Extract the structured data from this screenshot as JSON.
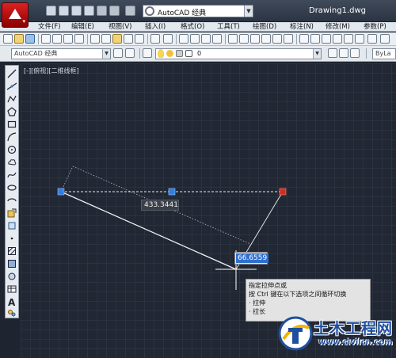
{
  "titlebar": {
    "workspace": "AutoCAD 经典",
    "window_title": "Drawing1.dwg"
  },
  "menu": {
    "items": [
      {
        "label": "文件(F)"
      },
      {
        "label": "编辑(E)"
      },
      {
        "label": "视图(V)"
      },
      {
        "label": "插入(I)"
      },
      {
        "label": "格式(O)"
      },
      {
        "label": "工具(T)"
      },
      {
        "label": "绘图(D)"
      },
      {
        "label": "标注(N)"
      },
      {
        "label": "修改(M)"
      },
      {
        "label": "参数(P)"
      }
    ]
  },
  "toolbar2": {
    "workspace_combo": "AutoCAD 经典",
    "layer_value": "0",
    "linetype_combo": "ByLa"
  },
  "viewport": {
    "label": "[-][俯视][二维线框]"
  },
  "dimensions": {
    "length": "433.3441",
    "angle": "66.6559"
  },
  "tooltip": {
    "lines": [
      "指定拉伸点或",
      "按 Ctrl 键在以下选项之间循环切换",
      "  · 拉伸",
      "  · 拉长"
    ]
  },
  "watermark": {
    "title": "土木工程网",
    "url": "www.civilcn.com"
  },
  "colors": {
    "canvas_bg": "#212733",
    "grip_blue": "#2f7fe0",
    "grip_red": "#d0301f",
    "selection_highlight": "#2f6fd0"
  },
  "icons": {
    "app": "autocad-logo-icon",
    "workspace_gear": "gear-icon",
    "tooltip_cursor": "crosshair-icon"
  }
}
